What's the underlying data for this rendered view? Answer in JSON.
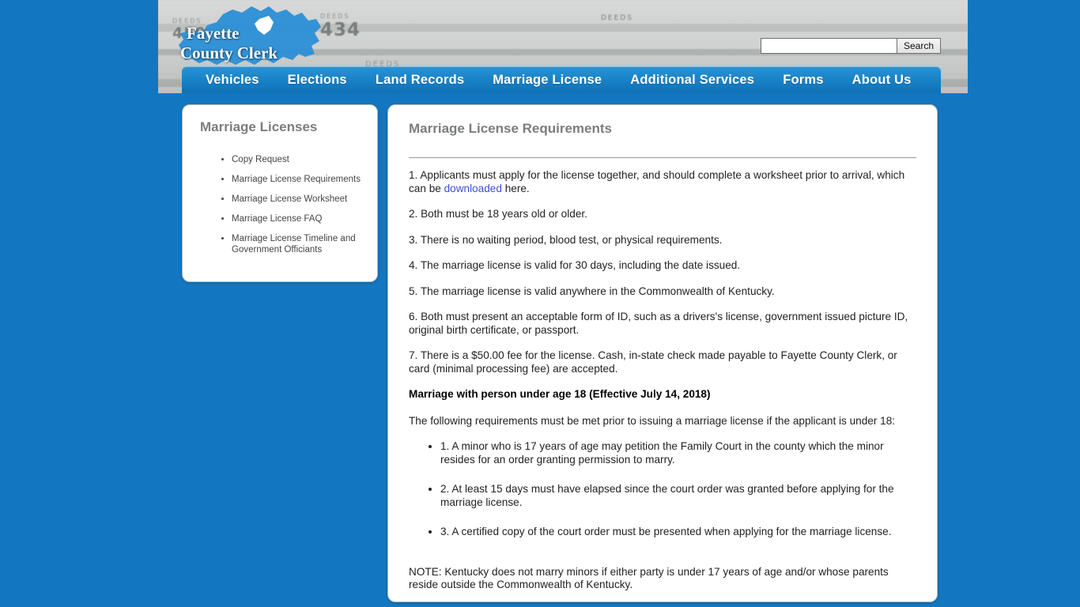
{
  "site": {
    "logo_line1": "Fayette",
    "logo_line2": "County Clerk",
    "header_shelf_labels": {
      "a": "450",
      "b": "434",
      "c": "DEEDS",
      "d": "DEEDS",
      "e": "DEEDS",
      "f": "DEEDS"
    }
  },
  "search": {
    "value": "",
    "placeholder": "",
    "button_label": "Search"
  },
  "nav": {
    "items": [
      {
        "label": "Vehicles"
      },
      {
        "label": "Elections"
      },
      {
        "label": "Land Records"
      },
      {
        "label": "Marriage License"
      },
      {
        "label": "Additional Services"
      },
      {
        "label": "Forms"
      },
      {
        "label": "About Us"
      }
    ]
  },
  "sidebar": {
    "title": "Marriage Licenses",
    "items": [
      {
        "label": "Copy Request"
      },
      {
        "label": "Marriage License Requirements"
      },
      {
        "label": "Marriage License Worksheet"
      },
      {
        "label": "Marriage License FAQ"
      },
      {
        "label": "Marriage License Timeline and Government Officiants"
      }
    ]
  },
  "content": {
    "title": "Marriage License Requirements",
    "req1_before": "1. Applicants must apply for the license together, and should complete a worksheet prior to arrival, which can be ",
    "req1_link": "downloaded",
    "req1_after": " here.",
    "req2": "2. Both must be 18 years old or older.",
    "req3": "3. There is no waiting period, blood test, or physical requirements.",
    "req4": "4. The marriage license is valid for 30 days, including the date issued.",
    "req5": "5. The marriage license is valid anywhere in the Commonwealth of Kentucky.",
    "req6": "6. Both must present an acceptable form of ID, such as a drivers's license, government issued picture ID, original birth certificate, or passport.",
    "req7": "7. There is a $50.00 fee for the license. Cash, in-state check made payable to Fayette County Clerk, or card (minimal processing fee) are accepted.",
    "minor_heading": "Marriage with person under age 18 (Effective July 14, 2018)",
    "minor_intro": "The following requirements must be met prior to issuing a marriage license if the applicant is under 18:",
    "minor_items": [
      "1. A minor who is 17 years of age may petition the Family Court in the county which the minor resides for an order granting permission to marry.",
      "2. At least 15 days must have elapsed since the court order was granted before applying for the marriage license.",
      "3. A certified copy of the court order must be presented when applying for the marriage license."
    ],
    "note": "NOTE: Kentucky does not marry minors if either party is under 17 years of age and/or whose parents reside outside the Commonwealth of Kentucky."
  },
  "colors": {
    "page_background": "#1277c0",
    "nav_blue": "#1a84c9",
    "logo_blue": "#2b8fd6",
    "link_blue": "#3b4fd8",
    "heading_gray": "#7b7d7f"
  }
}
